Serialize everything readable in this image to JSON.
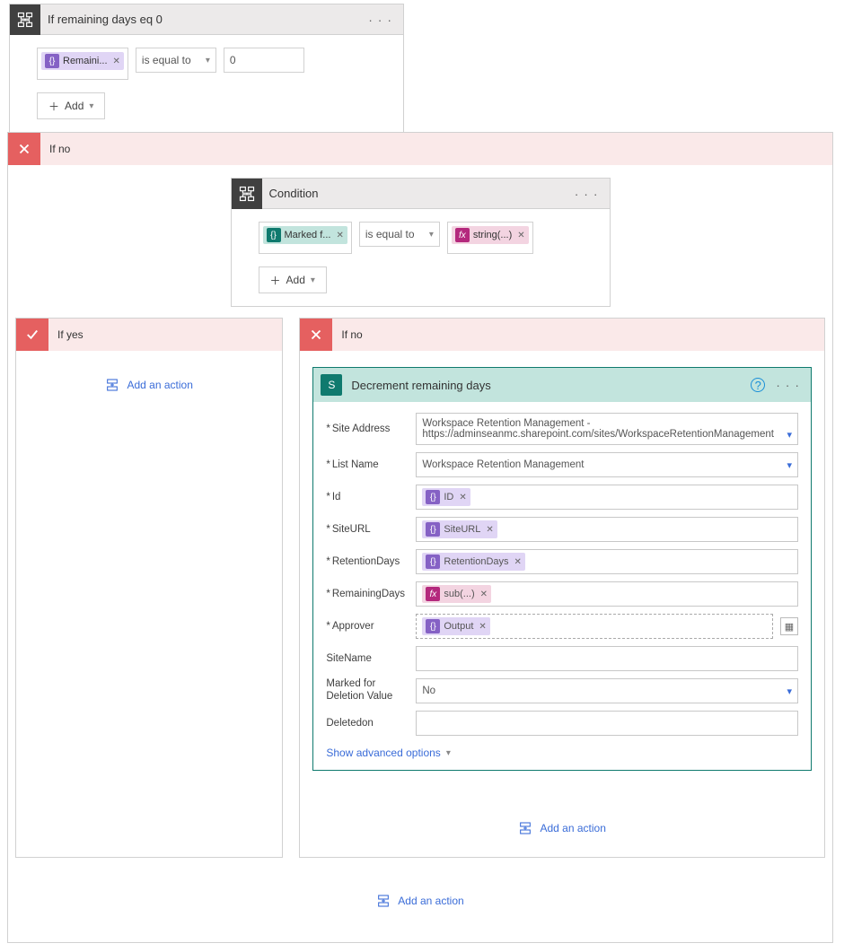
{
  "top_condition": {
    "title": "If remaining days eq 0",
    "left_pill": "Remaini...",
    "operator": "is equal to",
    "right_value": "0",
    "add_label": "Add"
  },
  "outer_no_label": "If no",
  "inner_condition": {
    "title": "Condition",
    "left_pill": "Marked f...",
    "operator": "is equal to",
    "right_pill": "string(...)",
    "add_label": "Add"
  },
  "yes_label": "If yes",
  "no_label": "If no",
  "add_action_label": "Add an action",
  "action": {
    "title": "Decrement remaining days",
    "fields": {
      "site_address": {
        "label": "Site Address",
        "value": "Workspace Retention Management - https://adminseanmc.sharepoint.com/sites/WorkspaceRetentionManagement"
      },
      "list_name": {
        "label": "List Name",
        "value": "Workspace Retention Management"
      },
      "id": {
        "label": "Id",
        "pill": "ID"
      },
      "site_url": {
        "label": "SiteURL",
        "pill": "SiteURL"
      },
      "retention_days": {
        "label": "RetentionDays",
        "pill": "RetentionDays"
      },
      "remaining_days": {
        "label": "RemainingDays",
        "pill": "sub(...)"
      },
      "approver": {
        "label": "Approver",
        "pill": "Output"
      },
      "site_name": {
        "label": "SiteName",
        "value": ""
      },
      "marked_for_deletion": {
        "label": "Marked for Deletion Value",
        "value": "No"
      },
      "deleted_on": {
        "label": "Deletedon",
        "value": ""
      }
    },
    "advanced": "Show advanced options"
  }
}
